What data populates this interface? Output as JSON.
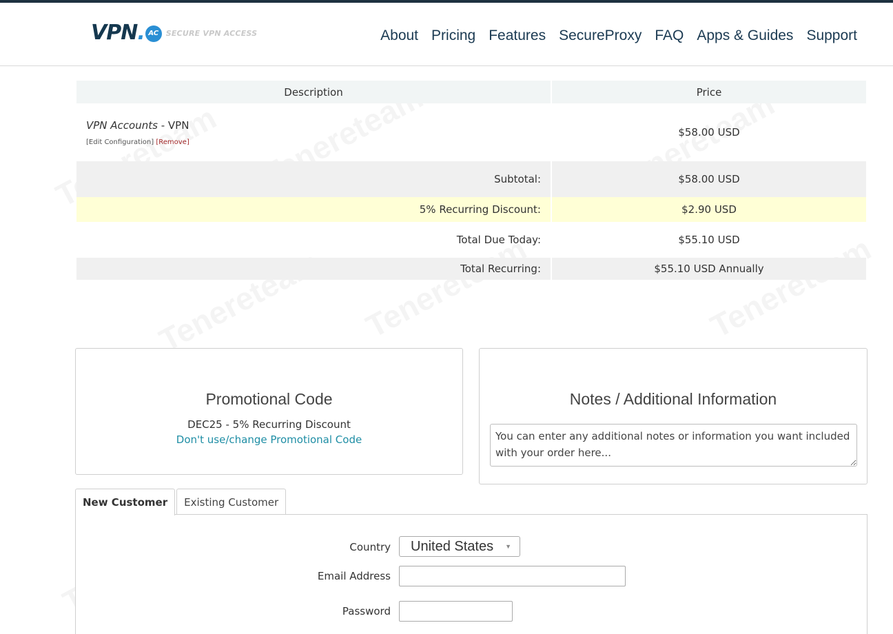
{
  "brand": {
    "logo_text": "VPN",
    "logo_dot": ".",
    "logo_badge": "AC",
    "tagline": "SECURE VPN ACCESS"
  },
  "nav": {
    "items": [
      "About",
      "Pricing",
      "Features",
      "SecureProxy",
      "FAQ",
      "Apps & Guides",
      "Support"
    ]
  },
  "cart": {
    "headers": {
      "description": "Description",
      "price": "Price"
    },
    "item": {
      "title": "VPN Accounts",
      "separator": " - ",
      "group": "VPN",
      "edit_link": "[Edit Configuration]",
      "remove_link": "[Remove]",
      "price": "$58.00 USD"
    },
    "subtotal": {
      "label": "Subtotal:",
      "value": "$58.00 USD"
    },
    "discount": {
      "label": "5% Recurring Discount:",
      "value": "$2.90 USD"
    },
    "total_due": {
      "label": "Total Due Today:",
      "value": "$55.10 USD"
    },
    "total_recurring": {
      "label": "Total Recurring:",
      "value": "$55.10 USD Annually"
    }
  },
  "promo": {
    "title": "Promotional Code",
    "applied": "DEC25 - 5% Recurring Discount",
    "change_link": "Don't use/change Promotional Code"
  },
  "notes": {
    "title": "Notes / Additional Information",
    "placeholder": "You can enter any additional notes or information you want included with your order here..."
  },
  "tabs": {
    "new_customer": "New Customer",
    "existing_customer": "Existing Customer"
  },
  "form": {
    "country_label": "Country",
    "country_value": "United States",
    "email_label": "Email Address",
    "email_value": "",
    "password_label": "Password",
    "password_value": ""
  },
  "watermark": "Tenereteam"
}
